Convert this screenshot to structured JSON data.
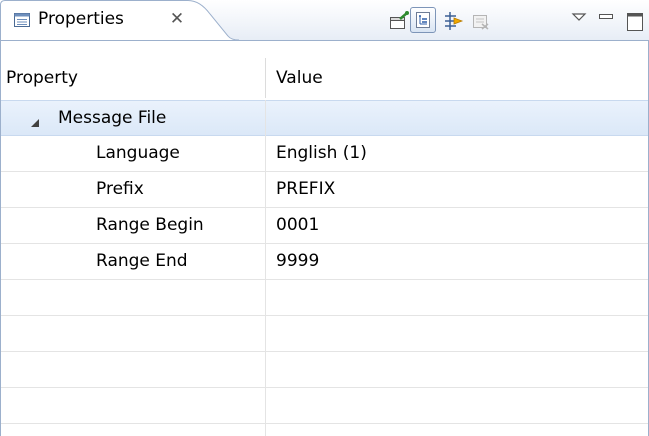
{
  "view": {
    "title": "Properties",
    "close_glyph": "✕"
  },
  "toolbar": {
    "items": [
      {
        "icon": "pin-to-selection-icon"
      },
      {
        "icon": "show-categories-icon",
        "pressed": true
      },
      {
        "icon": "show-advanced-properties-icon"
      },
      {
        "icon": "restore-default-value-icon",
        "disabled": true
      },
      {
        "icon": "view-menu-icon"
      },
      {
        "icon": "minimize-icon"
      },
      {
        "icon": "maximize-icon"
      }
    ]
  },
  "table": {
    "columns": [
      "Property",
      "Value"
    ],
    "category": {
      "label": "Message File",
      "expanded": true
    },
    "rows": [
      {
        "property": "Language",
        "value": "English (1)"
      },
      {
        "property": "Prefix",
        "value": "PREFIX"
      },
      {
        "property": "Range Begin",
        "value": "0001"
      },
      {
        "property": "Range End",
        "value": "9999"
      }
    ]
  },
  "colors": {
    "selection": "#dbe8f8",
    "border": "#9cb0cc",
    "grid": "#e4e4e4"
  }
}
